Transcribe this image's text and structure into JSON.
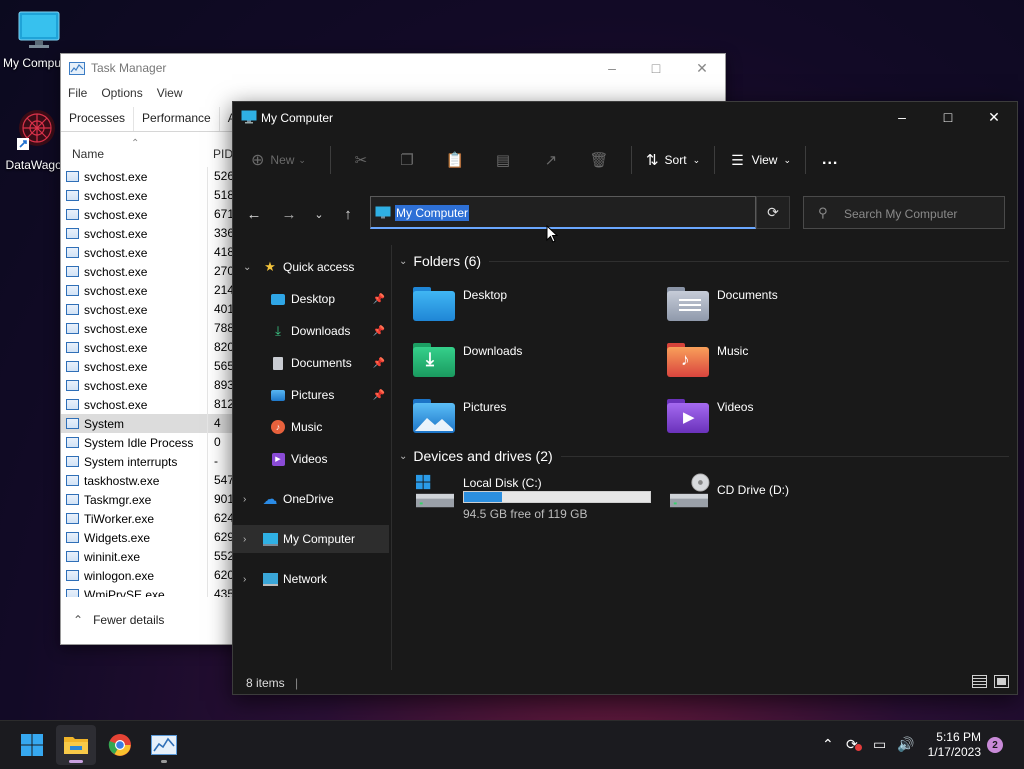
{
  "desktop": {
    "icons": [
      {
        "label": "My Computer",
        "icon": "monitor-icon"
      },
      {
        "label": "DataWagon",
        "icon": "datawagon-shortcut-icon"
      }
    ]
  },
  "task_manager": {
    "title": "Task Manager",
    "menu": [
      "File",
      "Options",
      "View"
    ],
    "tabs": [
      "Processes",
      "Performance",
      "App"
    ],
    "columns": {
      "name": "Name",
      "pid": "PID"
    },
    "processes": [
      {
        "name": "svchost.exe",
        "pid": "526"
      },
      {
        "name": "svchost.exe",
        "pid": "518"
      },
      {
        "name": "svchost.exe",
        "pid": "671"
      },
      {
        "name": "svchost.exe",
        "pid": "336"
      },
      {
        "name": "svchost.exe",
        "pid": "418"
      },
      {
        "name": "svchost.exe",
        "pid": "270"
      },
      {
        "name": "svchost.exe",
        "pid": "214"
      },
      {
        "name": "svchost.exe",
        "pid": "401"
      },
      {
        "name": "svchost.exe",
        "pid": "788"
      },
      {
        "name": "svchost.exe",
        "pid": "820"
      },
      {
        "name": "svchost.exe",
        "pid": "565"
      },
      {
        "name": "svchost.exe",
        "pid": "893"
      },
      {
        "name": "svchost.exe",
        "pid": "812"
      },
      {
        "name": "System",
        "pid": "4"
      },
      {
        "name": "System Idle Process",
        "pid": "0"
      },
      {
        "name": "System interrupts",
        "pid": "-"
      },
      {
        "name": "taskhostw.exe",
        "pid": "547"
      },
      {
        "name": "Taskmgr.exe",
        "pid": "901"
      },
      {
        "name": "TiWorker.exe",
        "pid": "624"
      },
      {
        "name": "Widgets.exe",
        "pid": "629"
      },
      {
        "name": "wininit.exe",
        "pid": "552"
      },
      {
        "name": "winlogon.exe",
        "pid": "620"
      },
      {
        "name": "WmiPrvSE.exe",
        "pid": "435"
      }
    ],
    "selected_process": "System",
    "footer": "Fewer details"
  },
  "explorer": {
    "title": "My Computer",
    "toolbar": {
      "new_label": "New",
      "sort_label": "Sort",
      "view_label": "View",
      "more_label": "..."
    },
    "address": "My Computer",
    "search_placeholder": "Search My Computer",
    "sidebar": {
      "quick_access": "Quick access",
      "pinned": [
        "Desktop",
        "Downloads",
        "Documents",
        "Pictures"
      ],
      "unpinned": [
        "Music",
        "Videos"
      ],
      "onedrive": "OneDrive",
      "this_pc": "My Computer",
      "network": "Network"
    },
    "folders_header": "Folders (6)",
    "folders": [
      "Desktop",
      "Documents",
      "Downloads",
      "Music",
      "Pictures",
      "Videos"
    ],
    "drives_header": "Devices and drives (2)",
    "drives": [
      {
        "name": "Local Disk (C:)",
        "free_text": "94.5 GB free of 119 GB",
        "used_fraction": 0.206
      },
      {
        "name": "CD Drive (D:)"
      }
    ],
    "status": "8 items"
  },
  "taskbar": {
    "time": "5:16 PM",
    "date": "1/17/2023",
    "notification_count": "2"
  },
  "colors": {
    "accent": "#2b8fe0",
    "selection": "#2e70d6",
    "explorer_bg": "#191919",
    "taskbar_bg": "#1b1b1f"
  }
}
